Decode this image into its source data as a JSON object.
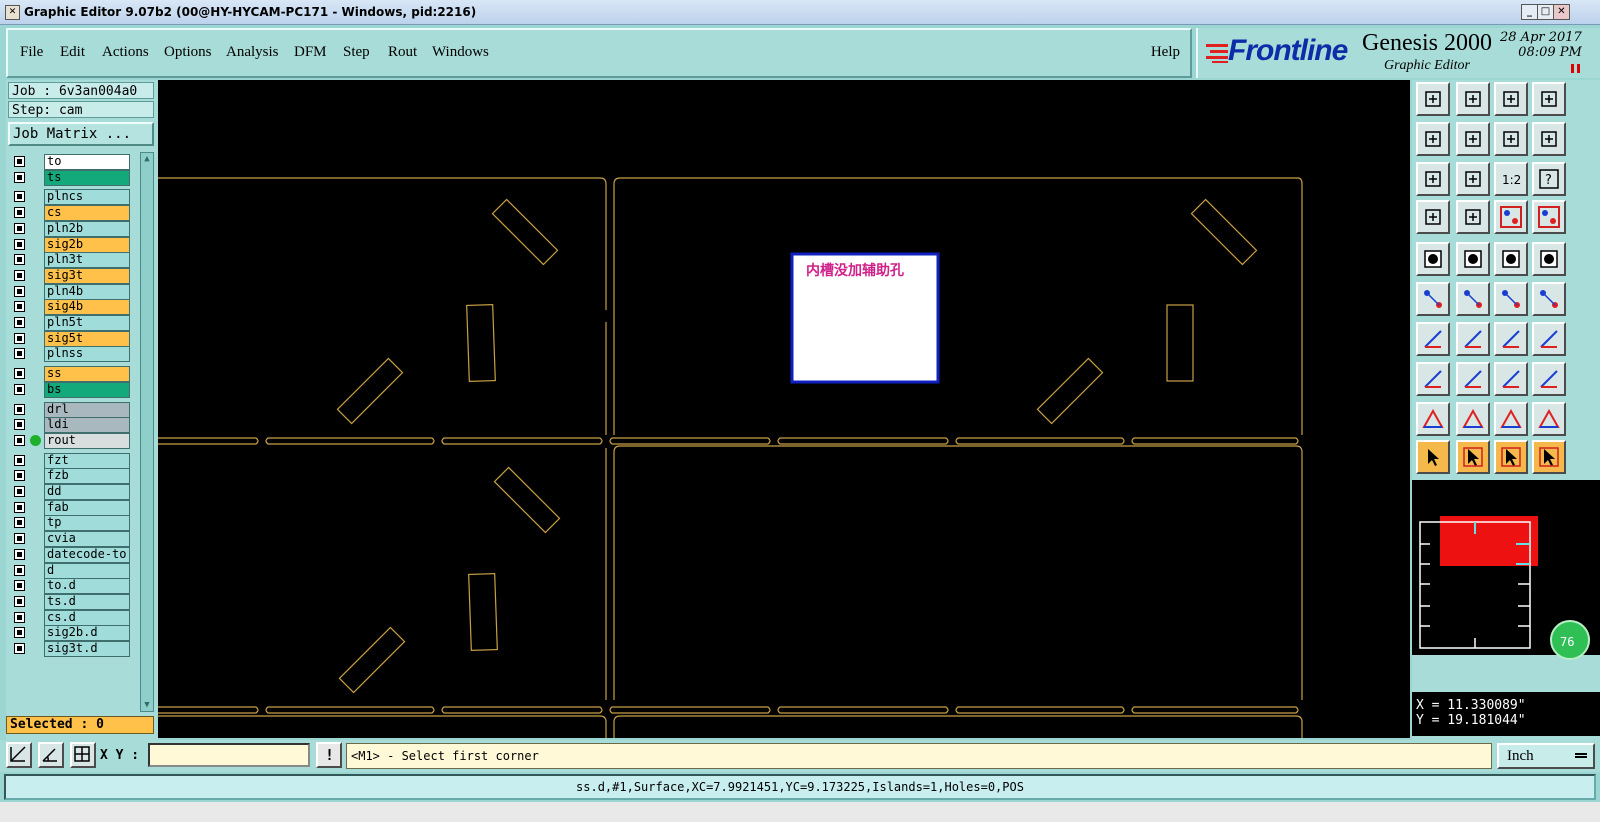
{
  "window": {
    "title": "Graphic Editor 9.07b2 (00@HY-HYCAM-PC171 - Windows, pid:2216)",
    "minimize": "_",
    "maximize": "□",
    "close": "✕"
  },
  "menu": {
    "items": [
      "File",
      "Edit",
      "Actions",
      "Options",
      "Analysis",
      "DFM",
      "Step",
      "Rout",
      "Windows"
    ],
    "help": "Help"
  },
  "brand": {
    "logo": "Frontline",
    "product": "Genesis 2000",
    "subtitle": "Graphic Editor",
    "date": "28 Apr 2017",
    "time": "08:09 PM"
  },
  "job": {
    "job_label": "Job : 6v3an004a0",
    "step_label": "Step: cam",
    "matrix_button": "Job Matrix ..."
  },
  "layers": [
    {
      "name": "to",
      "color": "#ffffff"
    },
    {
      "name": "ts",
      "color": "#14a97a"
    },
    {
      "name": "plncs",
      "color": "#9fdcda"
    },
    {
      "name": "cs",
      "color": "#ffc14a"
    },
    {
      "name": "pln2b",
      "color": "#9fdcda"
    },
    {
      "name": "sig2b",
      "color": "#ffc14a"
    },
    {
      "name": "pln3t",
      "color": "#9fdcda"
    },
    {
      "name": "sig3t",
      "color": "#ffc14a"
    },
    {
      "name": "pln4b",
      "color": "#9fdcda"
    },
    {
      "name": "sig4b",
      "color": "#ffc14a"
    },
    {
      "name": "pln5t",
      "color": "#9fdcda"
    },
    {
      "name": "sig5t",
      "color": "#ffc14a"
    },
    {
      "name": "plnss",
      "color": "#9fdcda"
    },
    {
      "name": "ss",
      "color": "#ffc14a"
    },
    {
      "name": "bs",
      "color": "#14a97a"
    },
    {
      "name": "drl",
      "color": "#a9b8be"
    },
    {
      "name": "ldi",
      "color": "#a9b8be"
    },
    {
      "name": "rout",
      "color": "#d8dedd",
      "active": true
    },
    {
      "name": "fzt",
      "color": "#9fdcda"
    },
    {
      "name": "fzb",
      "color": "#9fdcda"
    },
    {
      "name": "dd",
      "color": "#9fdcda"
    },
    {
      "name": "fab",
      "color": "#9fdcda"
    },
    {
      "name": "tp",
      "color": "#9fdcda"
    },
    {
      "name": "cvia",
      "color": "#9fdcda"
    },
    {
      "name": "datecode-to",
      "color": "#9fdcda"
    },
    {
      "name": "d",
      "color": "#9fdcda"
    },
    {
      "name": "to.d",
      "color": "#9fdcda"
    },
    {
      "name": "ts.d",
      "color": "#9fdcda"
    },
    {
      "name": "cs.d",
      "color": "#9fdcda"
    },
    {
      "name": "sig2b.d",
      "color": "#9fdcda"
    },
    {
      "name": "sig3t.d",
      "color": "#9fdcda"
    }
  ],
  "selected": "Selected : 0",
  "annotation": "内槽没加辅助孔",
  "coords": {
    "x": "X = 11.330089\"",
    "y": "Y = 19.181044\""
  },
  "zoom_badge": "76",
  "bottom": {
    "xy_label": "X Y :",
    "xy_value": "",
    "prompt": "<M1> - Select first corner",
    "unit": "Inch"
  },
  "status": "ss.d,#1,Surface,XC=7.9921451,YC=9.173225,Islands=1,Holes=0,POS",
  "tool_label_ratio": "1:2",
  "tool_label_help": "?",
  "colors": {
    "outline": "#c8a046",
    "accent_red": "#ee1111",
    "panel": "#a7dcd8",
    "selected_tool": "#f5b84a"
  }
}
